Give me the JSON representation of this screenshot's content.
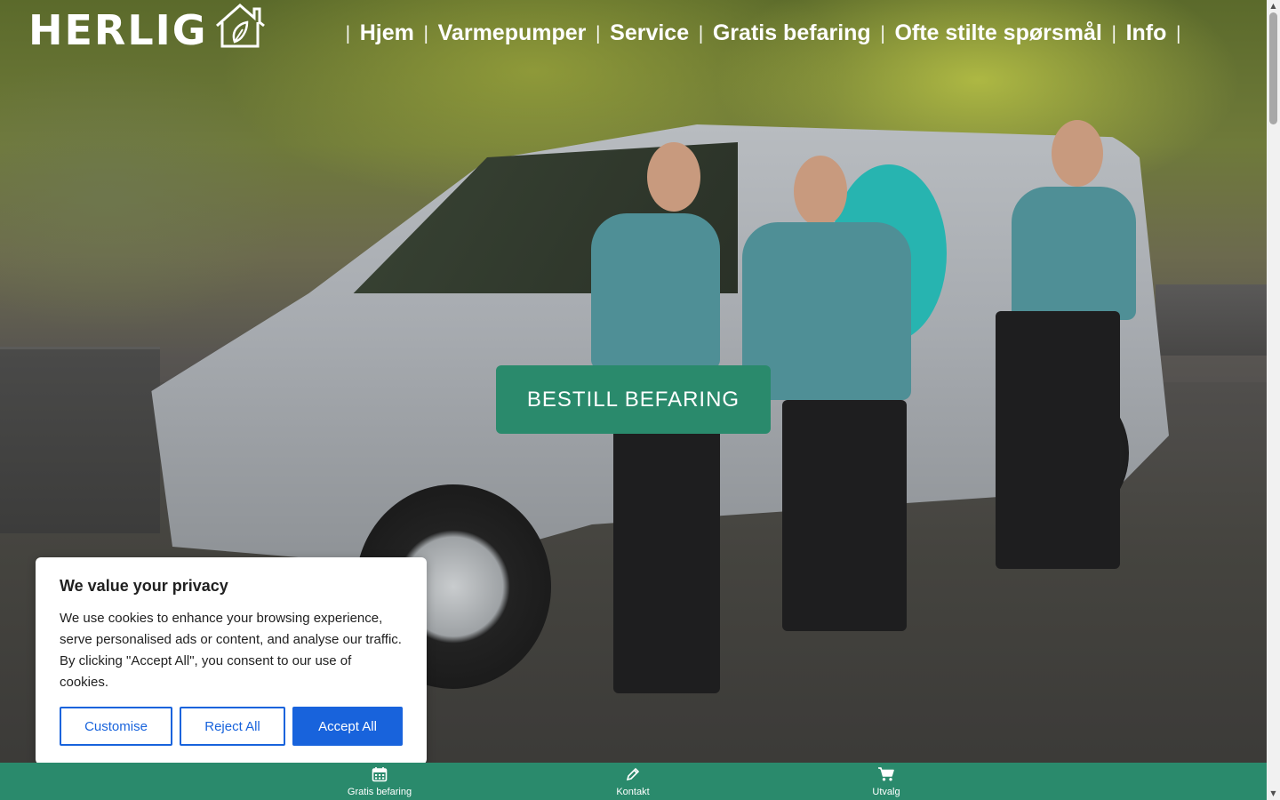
{
  "logo": {
    "text": "HERLIG",
    "icon": "house-leaf-icon"
  },
  "nav": {
    "items": [
      {
        "label": "Hjem"
      },
      {
        "label": "Varmepumper"
      },
      {
        "label": "Service"
      },
      {
        "label": "Gratis befaring"
      },
      {
        "label": "Ofte stilte spørsmål"
      },
      {
        "label": "Info"
      }
    ],
    "separator": "|"
  },
  "hero": {
    "cta_label": "BESTILL BEFARING"
  },
  "cookie_banner": {
    "title": "We value your privacy",
    "body": "We use cookies to enhance your browsing experience, serve personalised ads or content, and analyse our traffic. By clicking \"Accept All\", you consent to our use of cookies.",
    "buttons": {
      "customise": "Customise",
      "reject": "Reject All",
      "accept": "Accept All"
    }
  },
  "bottom_bar": {
    "items": [
      {
        "label": "Gratis befaring",
        "icon": "calendar-icon"
      },
      {
        "label": "Kontakt",
        "icon": "pencil-icon"
      },
      {
        "label": "Utvalg",
        "icon": "cart-icon"
      }
    ]
  },
  "colors": {
    "brand_green": "#2a8a6c",
    "cookie_button_blue": "#1863dc"
  }
}
